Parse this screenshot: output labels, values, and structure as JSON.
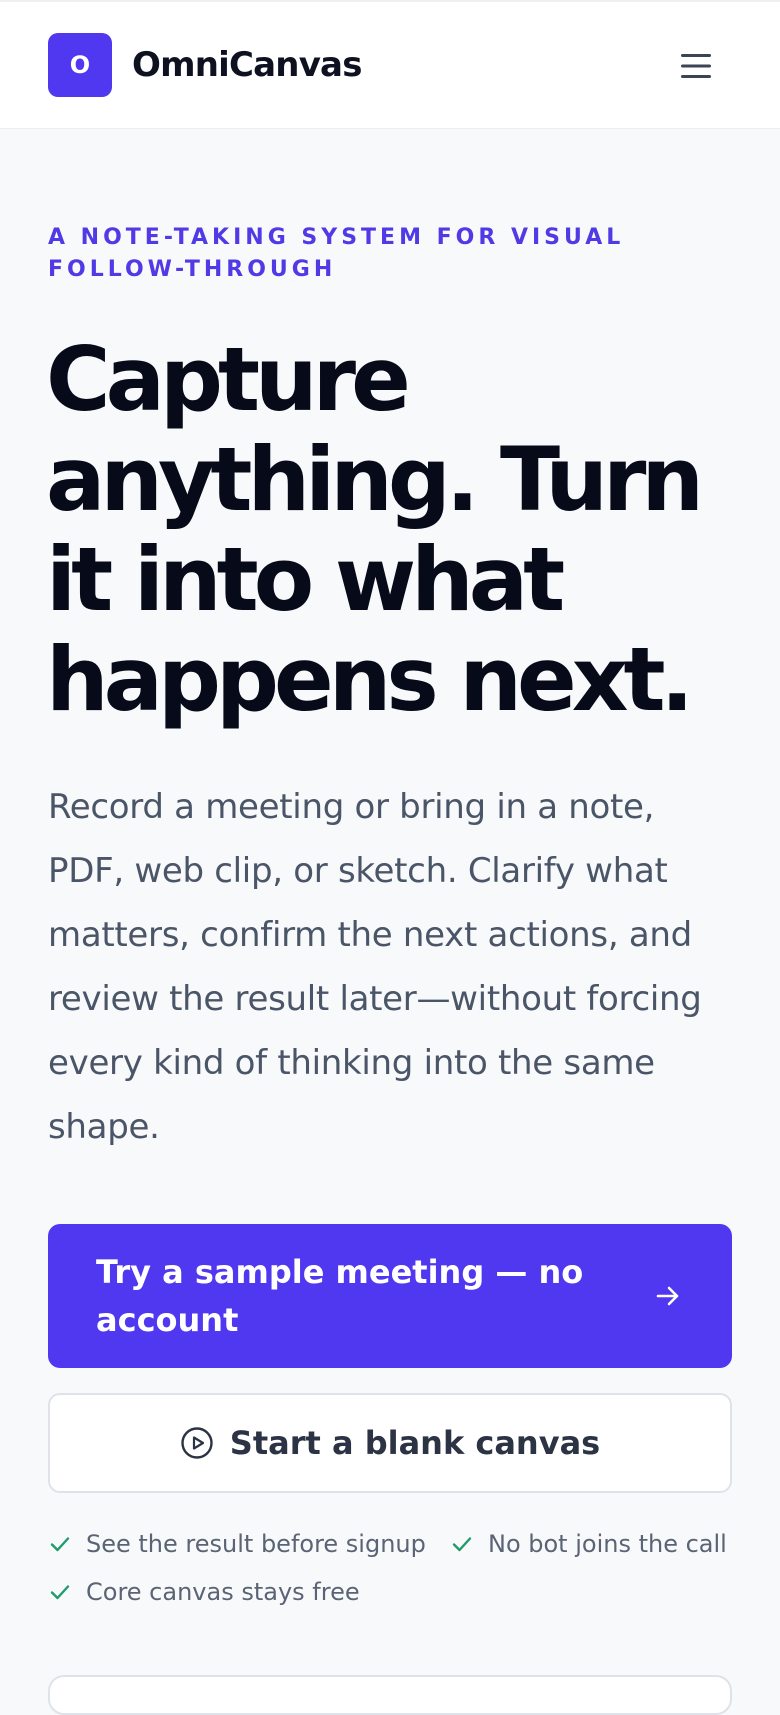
{
  "header": {
    "logo_letter": "O",
    "brand_name": "OmniCanvas",
    "menu_icon": "hamburger-menu-icon"
  },
  "hero": {
    "eyebrow": "A NOTE-TAKING SYSTEM FOR VISUAL FOLLOW-THROUGH",
    "headline": "Capture anything. Turn it into what happens next.",
    "lede": "Record a meeting or bring in a note, PDF, web clip, or sketch. Clarify what matters, confirm the next actions, and review the result later—without forcing every kind of thinking into the same shape."
  },
  "cta": {
    "primary_label": "Try a sample meeting — no account",
    "primary_icon": "arrow-right-icon",
    "secondary_label": "Start a blank canvas",
    "secondary_icon": "play-circle-icon"
  },
  "perks": [
    {
      "label": "See the result before signup",
      "icon": "check-icon"
    },
    {
      "label": "No bot joins the call",
      "icon": "check-icon"
    },
    {
      "label": "Core canvas stays free",
      "icon": "check-icon"
    }
  ],
  "colors": {
    "accent": "#5038f0",
    "check": "#1f9d6b",
    "text": "#070a18",
    "muted": "#4b5568"
  }
}
